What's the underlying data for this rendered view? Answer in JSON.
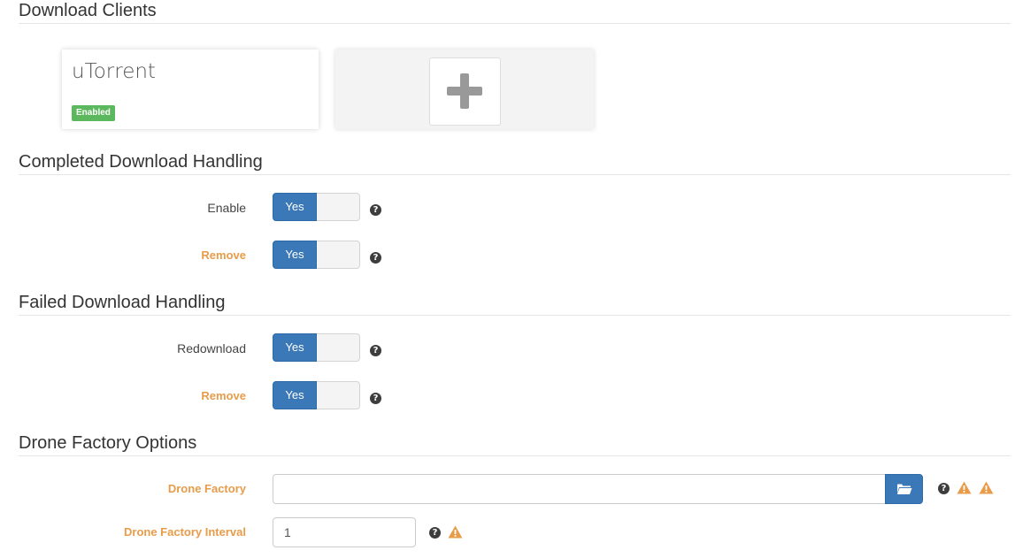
{
  "sections": {
    "download_clients": "Download Clients",
    "completed_handling": "Completed Download Handling",
    "failed_handling": "Failed Download Handling",
    "drone_factory": "Drone Factory Options"
  },
  "client": {
    "name": "uTorrent",
    "status": "Enabled"
  },
  "completed": {
    "enable_label": "Enable",
    "enable_value": "Yes",
    "remove_label": "Remove",
    "remove_value": "Yes"
  },
  "failed": {
    "redownload_label": "Redownload",
    "redownload_value": "Yes",
    "remove_label": "Remove",
    "remove_value": "Yes"
  },
  "drone": {
    "factory_label": "Drone Factory",
    "factory_value": "",
    "interval_label": "Drone Factory Interval",
    "interval_value": "1"
  },
  "icons": {
    "help": "?",
    "help_icon": "question-circle-icon",
    "warning_icon": "warning-icon",
    "folder_icon": "folder-open-icon",
    "add_icon": "plus-icon"
  },
  "colors": {
    "primary": "#3a78b8",
    "success": "#5cb85c",
    "advanced_label": "#e89c4a",
    "warning": "#e89c4a"
  }
}
